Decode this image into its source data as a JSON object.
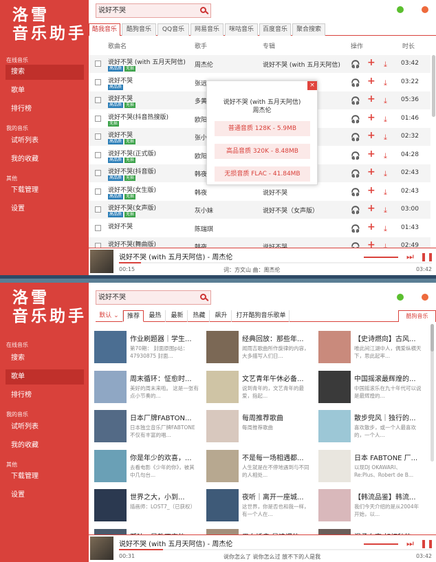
{
  "app": {
    "logo_line1": "洛雪",
    "logo_line2": "音乐助手",
    "nav": {
      "online_label": "在线音乐",
      "search": "搜索",
      "songlist": "歌单",
      "leaderboard": "排行榜",
      "my_music_label": "我的音乐",
      "trial_list": "试听列表",
      "my_favorites": "我的收藏",
      "other_label": "其他",
      "download_manage": "下载管理",
      "settings": "设置"
    },
    "colors": {
      "accent": "#d9413b",
      "sidebar": "#d9413b",
      "control_green": "#5bbf2f",
      "control_orange": "#ee6a3c"
    }
  },
  "window1": {
    "search_value": "说好不哭",
    "source_tabs": [
      "酷我音乐",
      "酷狗音乐",
      "QQ音乐",
      "网易音乐",
      "咪咕音乐",
      "百度音乐",
      "聚合搜索"
    ],
    "active_source": "酷我音乐",
    "columns": {
      "name": "歌曲名",
      "singer": "歌手",
      "album": "专辑",
      "ops": "操作",
      "duration": "时长"
    },
    "rows": [
      {
        "name": "说好不哭 (with 五月天阿信)",
        "tags": [
          "高品质",
          "无损"
        ],
        "singer": "周杰伦",
        "album": "说好不哭 (with 五月天阿信)",
        "time": "03:42"
      },
      {
        "name": "说好不哭",
        "tags": [
          "高品质"
        ],
        "singer": "张远",
        "album": "",
        "time": "03:22"
      },
      {
        "name": "说好不哭",
        "tags": [
          "高品质",
          "无损"
        ],
        "singer": "多黄",
        "album": "",
        "time": "05:36"
      },
      {
        "name": "说好不哭(抖音热搜版)",
        "tags": [
          "无损"
        ],
        "singer": "欧阳泽",
        "album": "",
        "time": "01:46"
      },
      {
        "name": "说好不哭",
        "tags": [
          "高品质",
          "无损"
        ],
        "singer": "张小",
        "album": "",
        "time": "02:32"
      },
      {
        "name": "说好不哭(正式版)",
        "tags": [
          "高品质",
          "无损"
        ],
        "singer": "欧阳泽",
        "album": "",
        "time": "04:28"
      },
      {
        "name": "说好不哭(抖音版)",
        "tags": [
          "高品质",
          "无损"
        ],
        "singer": "韩夜",
        "album": "",
        "time": "02:43"
      },
      {
        "name": "说好不哭(女生版)",
        "tags": [
          "高品质",
          "无损"
        ],
        "singer": "韩夜",
        "album": "说好不哭",
        "time": "02:43"
      },
      {
        "name": "说好不哭(女声版)",
        "tags": [
          "高品质",
          "无损"
        ],
        "singer": "灰小妹",
        "album": "说好不哭（女声版）",
        "time": "03:00"
      },
      {
        "name": "说好不哭",
        "tags": [],
        "singer": "陈瑞琪",
        "album": "",
        "time": "01:43"
      },
      {
        "name": "说好不哭(舞曲版)",
        "tags": [
          "高品质",
          "无损"
        ],
        "singer": "韩夜",
        "album": "说好不哭",
        "time": "02:49"
      }
    ],
    "modal": {
      "close": "×",
      "title": "说好不哭 (with 五月天阿信)",
      "artist": "周杰伦",
      "options": [
        "普通音质 128K - 5.9MB",
        "高品音质 320K - 8.48MB",
        "无损音质 FLAC - 41.84MB"
      ]
    },
    "player": {
      "title": "说好不哭 (with 五月天阿信) - 周杰伦",
      "current": "00:15",
      "total": "03:42",
      "lyric": "词：方文山 曲：周杰伦",
      "progress": 0.07
    }
  },
  "window2": {
    "search_value": "说好不哭",
    "sort_label": "默认",
    "categories": [
      "推荐",
      "最热",
      "最新",
      "热藏",
      "飙升",
      "打开酷狗音乐歌单"
    ],
    "active_category": "推荐",
    "source_label": "酷狗音乐",
    "cards": [
      {
        "title": "作业刷题器｜学生...",
        "desc": "第70期： 封面原图p站：47930875 封面...",
        "color": "#4b6e92"
      },
      {
        "title": "经典回放：那些年...",
        "desc": "闻雨吉歌曲所作旋律的内容，大多描写人们日...",
        "color": "#7b6855"
      },
      {
        "title": "【史诗燃向】古风...",
        "desc": "唯此间江湖中人，偶爱纵横天下，思此起率...",
        "color": "#c98a7c"
      },
      {
        "title": "周末循环：怔愈时...",
        "desc": "美好的周末来啦。 这是一张有点小节奏的...",
        "color": "#8fa7c4"
      },
      {
        "title": "文艺青年午休必备...",
        "desc": "说到青年的，文艺青年的最爱，指起...",
        "color": "#cfc4a5"
      },
      {
        "title": "中国摇滚最辉煌的...",
        "desc": "中国摇滚乐在九十年代可以说是最辉煌的...",
        "color": "#3a3a3a"
      },
      {
        "title": "日本厂牌FABTON...",
        "desc": "日本独立音乐厂牌FABTONE不仅有丰富的唱...",
        "color": "#536a86"
      },
      {
        "title": "每周推荐歌曲",
        "desc": "每周推荐歌曲",
        "color": "#d8c8be"
      },
      {
        "title": "散步兜风｜独行的...",
        "desc": "喜欢散步，或一个人最喜欢的，一个人...",
        "color": "#9cc7d6"
      },
      {
        "title": "你是年少的欢喜，...",
        "desc": "去看电影《少年的你》，被其中几句台...",
        "color": "#6aa0b6"
      },
      {
        "title": "不是每一场相遇都...",
        "desc": "人生就是在不停地遇到与不同的人相处...",
        "color": "#b7a890"
      },
      {
        "title": "日本 FABTONE 厂...",
        "desc": "以现DJ OKAWARI、Re:Plus、Robert de B...",
        "color": "#e9e6df"
      },
      {
        "title": "世界之大，小到...",
        "desc": "插画师：LOST7_（已获权）",
        "color": "#2b3950"
      },
      {
        "title": "夜听｜离开一座城...",
        "desc": "这世界，你是否也和我一样，有一个人在...",
        "color": "#3e5a78"
      },
      {
        "title": "【韩流品鉴】韩流...",
        "desc": "我们今天介绍的是从2004年开始，以...",
        "color": "#d9b8bb"
      },
      {
        "title": "孤独，是教不完的...",
        "desc": "",
        "color": "#4b5a6c"
      },
      {
        "title": "男女插肩·最浪漫的...",
        "desc": "",
        "color": "#a38f7b"
      },
      {
        "title": "温柔女声·如初秋的...",
        "desc": "",
        "color": "#6b5e5a"
      }
    ],
    "player": {
      "title": "说好不哭 (with 五月天阿信) - 周杰伦",
      "current": "00:31",
      "total": "03:42",
      "lyric": "说你怎么了 说你怎么过 放不下的人是我",
      "progress": 0.14
    }
  },
  "icons": {
    "headphone": "headphone-icon",
    "add": "add-icon",
    "download": "download-icon",
    "next": "next-icon",
    "pause": "pause-icon"
  }
}
